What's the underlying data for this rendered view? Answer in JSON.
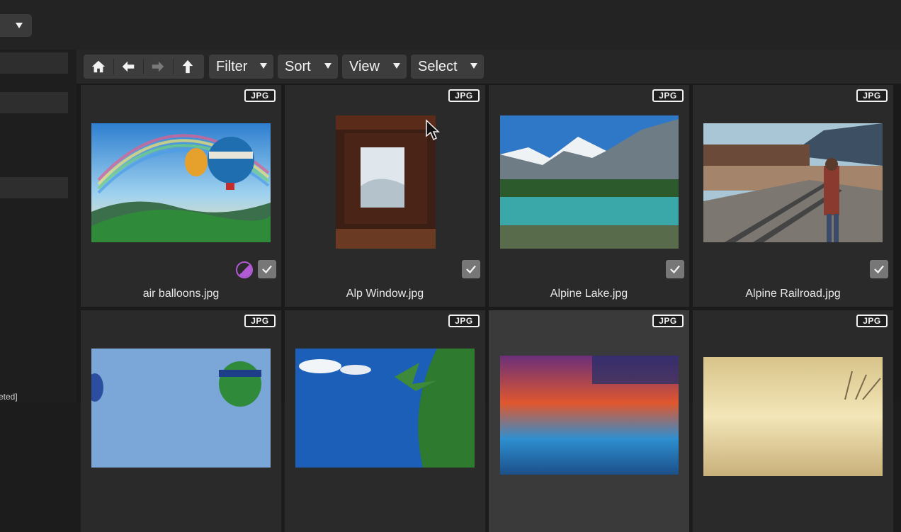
{
  "toolbar": {
    "nav": {
      "home": "home-icon",
      "back": "arrow-left-icon",
      "forward": "arrow-right-icon",
      "up": "arrow-up-icon"
    },
    "filter_label": "Filter",
    "sort_label": "Sort",
    "view_label": "View",
    "select_label": "Select"
  },
  "sidebar": {
    "partial_text": "eted]"
  },
  "grid": {
    "items": [
      {
        "name": "air balloons.jpg",
        "type": "JPG",
        "checked": true,
        "color_label": "purple"
      },
      {
        "name": "Alp Window.jpg",
        "type": "JPG",
        "checked": true
      },
      {
        "name": "Alpine Lake.jpg",
        "type": "JPG",
        "checked": true
      },
      {
        "name": "Alpine Railroad.jpg",
        "type": "JPG",
        "checked": true
      },
      {
        "name": "",
        "type": "JPG"
      },
      {
        "name": "",
        "type": "JPG"
      },
      {
        "name": "",
        "type": "JPG"
      },
      {
        "name": "",
        "type": "JPG"
      }
    ]
  },
  "colors": {
    "accent_label": "#b15bd6",
    "badge_border": "#f2f2f2",
    "check_bg": "#777777"
  }
}
